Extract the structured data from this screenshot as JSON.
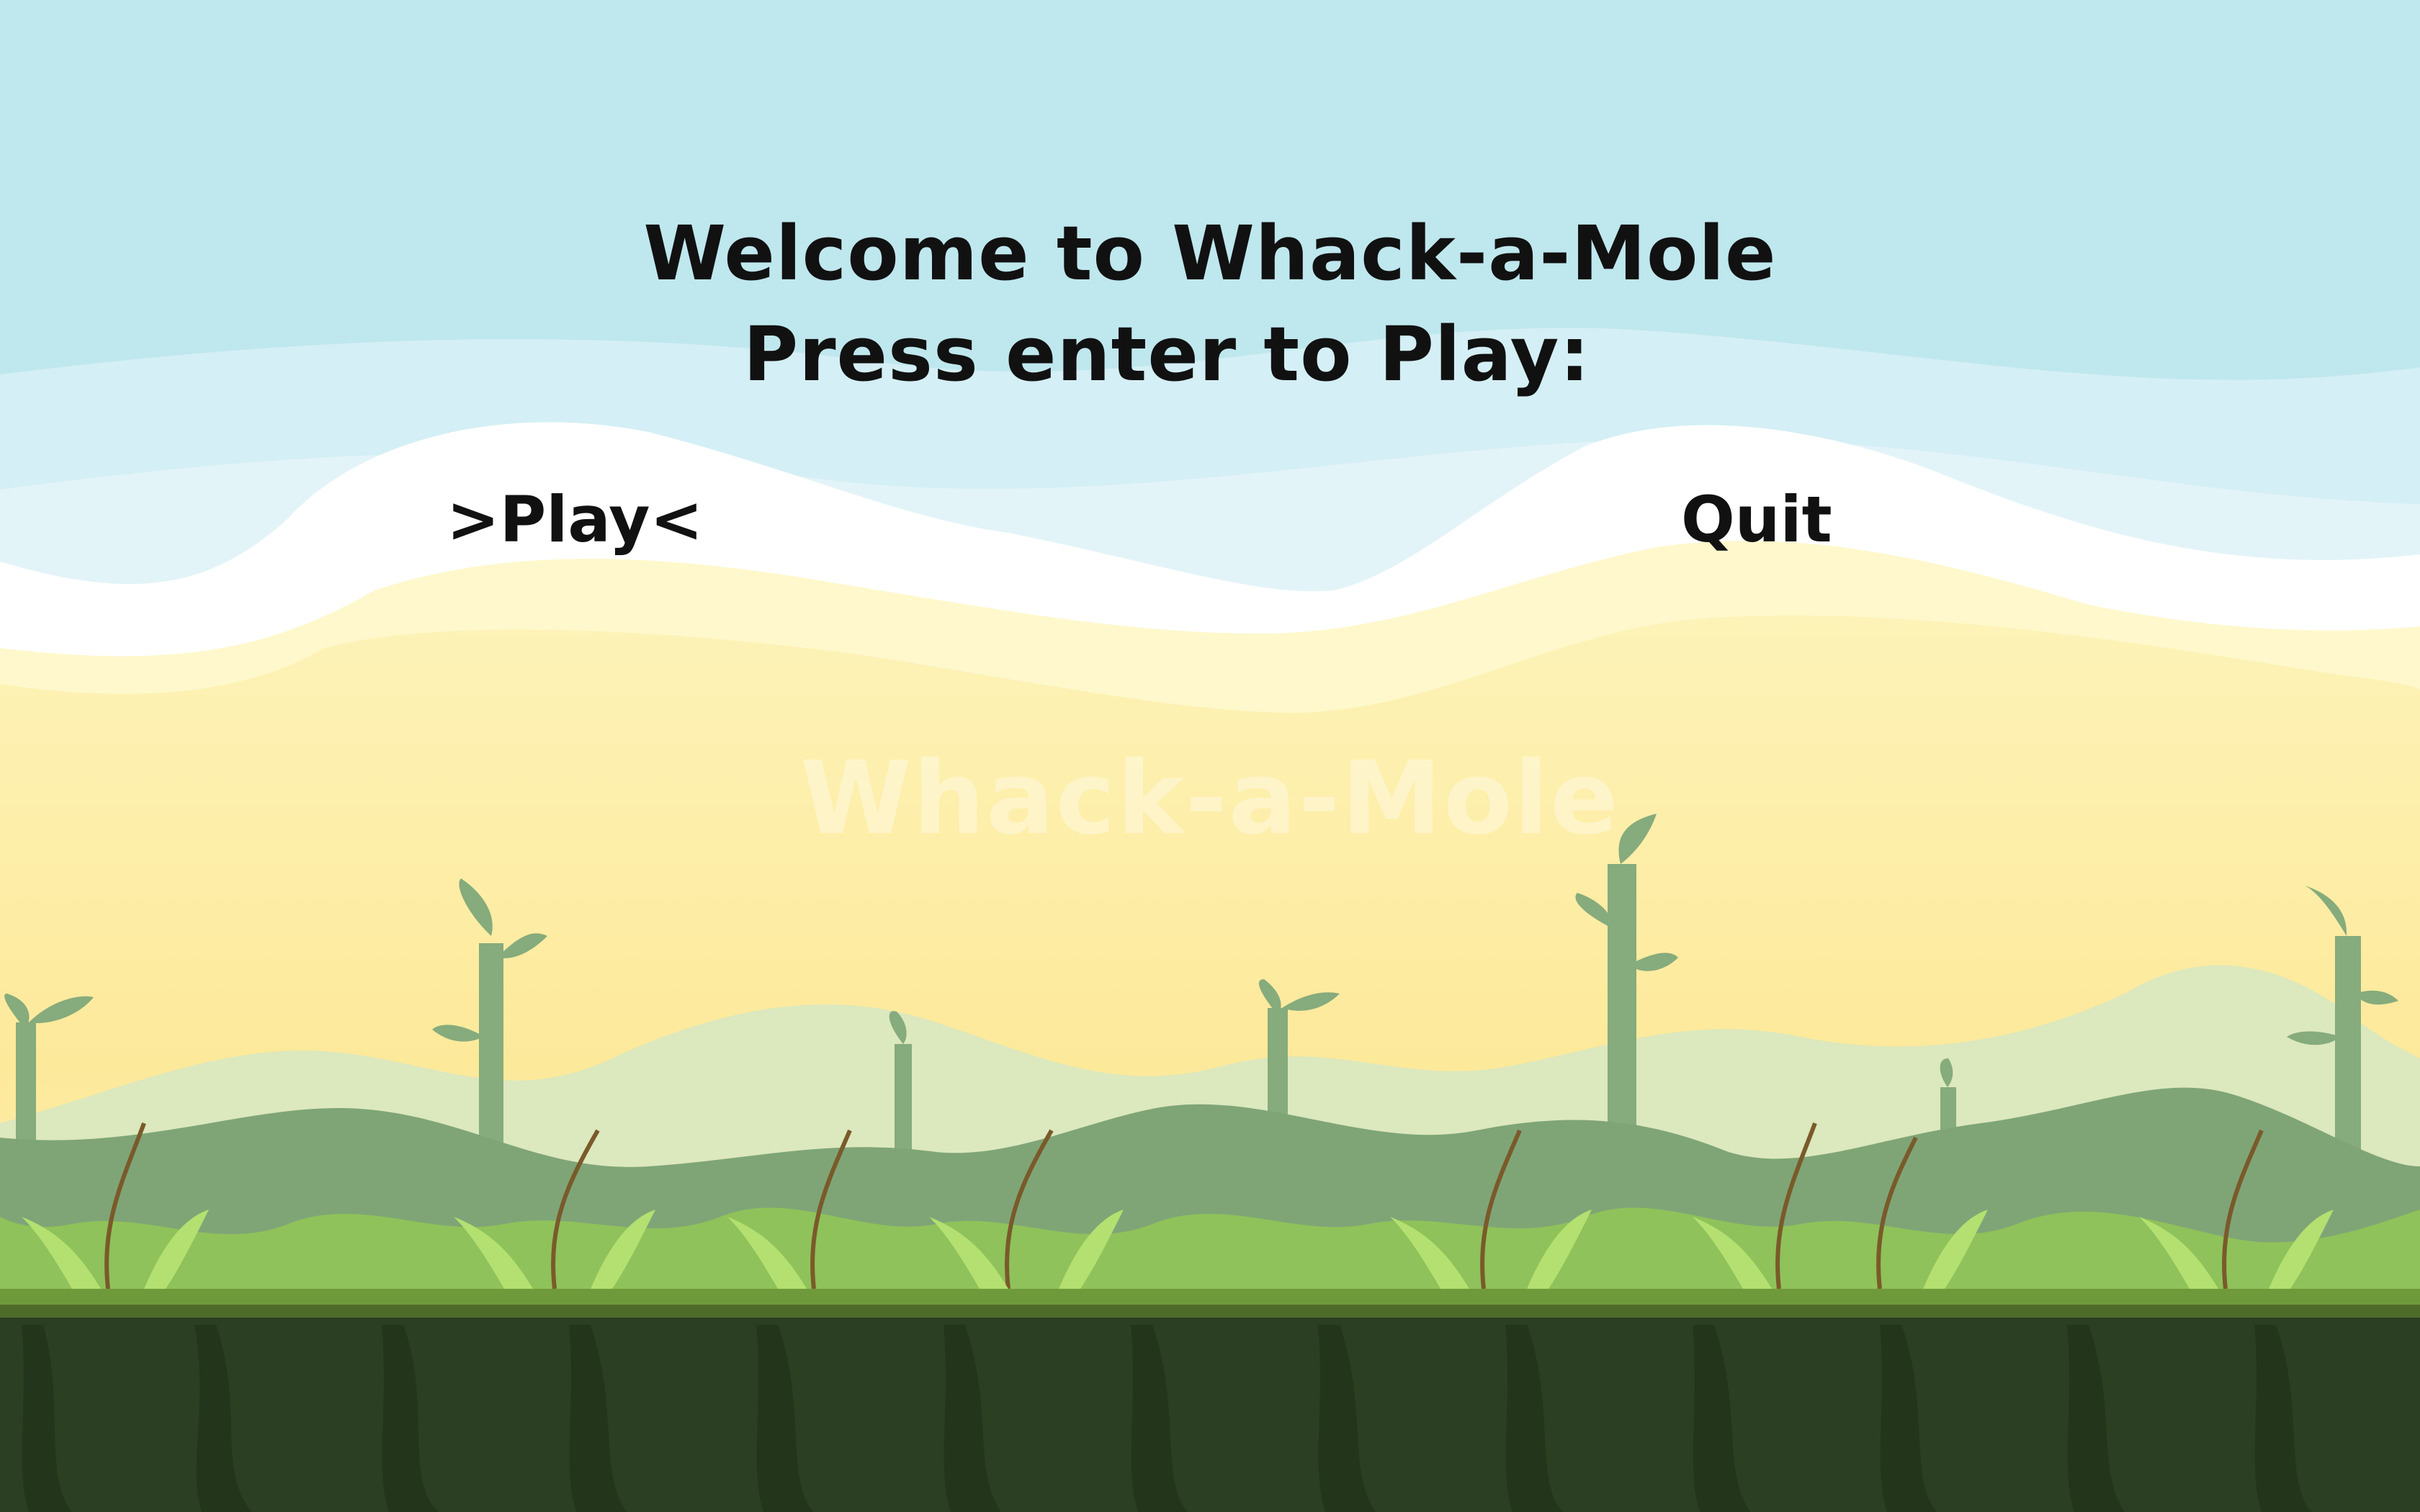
{
  "game": {
    "title_line_1": "Welcome to Whack-a-Mole",
    "title_line_2": "Press enter to Play:",
    "menu": {
      "play_label": ">Play<",
      "quit_label": "Quit",
      "selected": "Play"
    },
    "watermark": "Whack-a-Mole"
  },
  "colors": {
    "sky": "#bfe7ee",
    "cloud": "#ffffff",
    "sand": "#fdec9a",
    "far_hills": "#dbe8bf",
    "near_hills": "#7ea477",
    "grass": "#9ed45a",
    "ground": "#2b3f22",
    "text": "#111111"
  }
}
